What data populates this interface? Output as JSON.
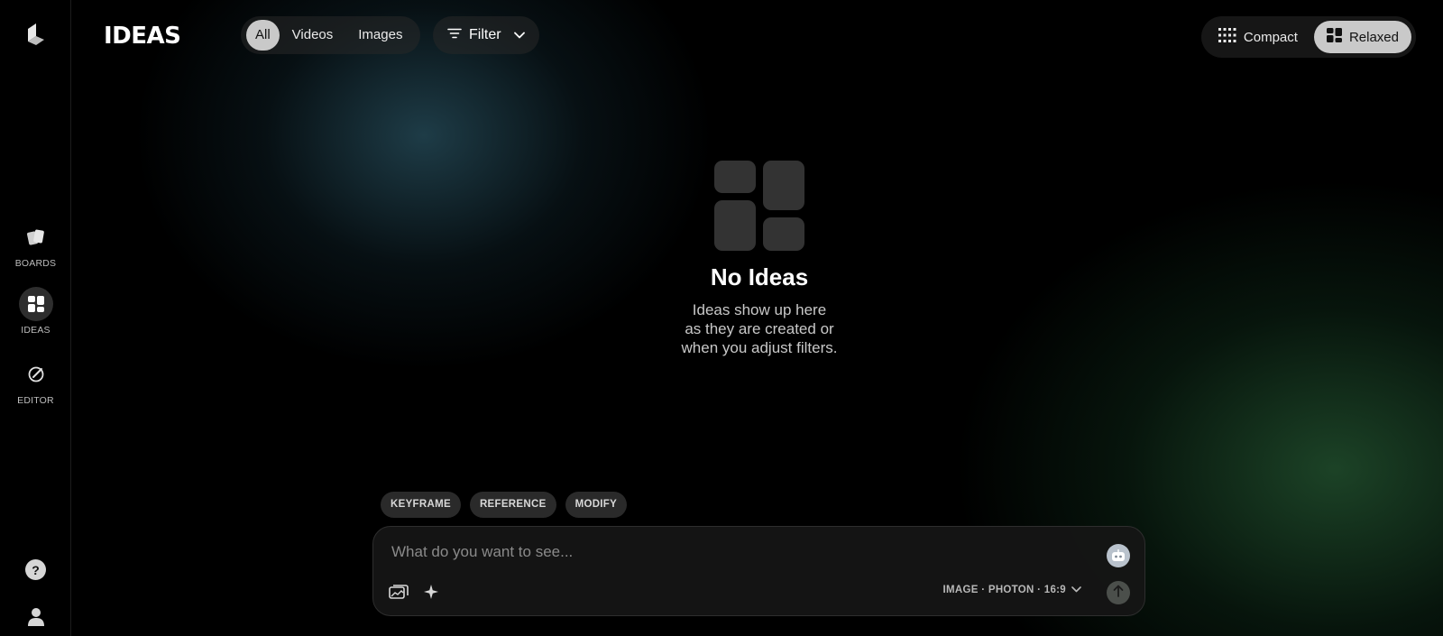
{
  "brand": "IDEAS",
  "sidebar": {
    "items": [
      {
        "label": "BOARDS",
        "icon": "boards-icon"
      },
      {
        "label": "IDEAS",
        "icon": "ideas-grid-icon",
        "active": true
      },
      {
        "label": "EDITOR",
        "icon": "editor-icon"
      }
    ],
    "help_label": "?"
  },
  "media_filter": {
    "options": [
      "All",
      "Videos",
      "Images"
    ],
    "selected": "All"
  },
  "filter": {
    "label": "Filter"
  },
  "view_toggle": {
    "options": [
      "Compact",
      "Relaxed"
    ],
    "selected": "Relaxed"
  },
  "empty_state": {
    "title": "No Ideas",
    "lines": [
      "Ideas show up here",
      "as they are created or",
      "when you adjust filters."
    ]
  },
  "prompt": {
    "chips": [
      "KEYFRAME",
      "REFERENCE",
      "MODIFY"
    ],
    "placeholder": "What do you want to see...",
    "settings": "IMAGE · PHOTON · 16:9"
  },
  "colors": {
    "background": "#000000",
    "active_pill": "#c9c9c9",
    "chip_bg": "#2a2a2a"
  }
}
